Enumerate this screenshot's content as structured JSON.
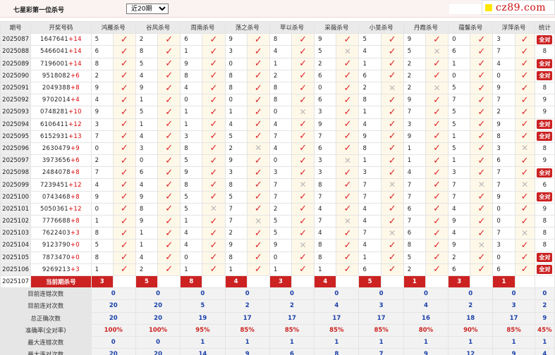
{
  "header": {
    "title": "七星彩第一位杀号",
    "period_select": "近20期"
  },
  "logo": {
    "text": "cz89.com"
  },
  "columns": {
    "issue": "期号",
    "draw": "开奖号码",
    "experts": [
      "鸿雁杀号",
      "谷风杀号",
      "周南杀号",
      "荡之杀号",
      "苹以杀号",
      "采薇杀号",
      "小旻杀号",
      "丹霞杀号",
      "蕴馨杀号",
      "浮萍杀号"
    ],
    "stat": "统计"
  },
  "rows": [
    {
      "issue": "2025087",
      "draw": "1647641",
      "plus": "+14",
      "kills": [
        "5",
        "2",
        "6",
        "9",
        "8",
        "9",
        "5",
        "9",
        "0",
        "3"
      ],
      "hits": [
        1,
        1,
        1,
        1,
        1,
        1,
        1,
        1,
        1,
        1
      ],
      "stat": "全对"
    },
    {
      "issue": "2025088",
      "draw": "5466041",
      "plus": "+14",
      "kills": [
        "6",
        "8",
        "1",
        "3",
        "4",
        "5",
        "4",
        "5",
        "6",
        "7"
      ],
      "hits": [
        1,
        1,
        1,
        1,
        1,
        0,
        1,
        0,
        1,
        1
      ],
      "stat": "8"
    },
    {
      "issue": "2025089",
      "draw": "7196001",
      "plus": "+14",
      "kills": [
        "8",
        "5",
        "9",
        "0",
        "1",
        "2",
        "1",
        "2",
        "1",
        "4"
      ],
      "hits": [
        1,
        1,
        1,
        1,
        1,
        1,
        1,
        1,
        1,
        1
      ],
      "stat": "全对"
    },
    {
      "issue": "2025090",
      "draw": "9518082",
      "plus": "+6",
      "kills": [
        "2",
        "4",
        "8",
        "8",
        "2",
        "6",
        "6",
        "2",
        "0",
        "0"
      ],
      "hits": [
        1,
        1,
        1,
        1,
        1,
        1,
        1,
        1,
        1,
        1
      ],
      "stat": "全对"
    },
    {
      "issue": "2025091",
      "draw": "2049388",
      "plus": "+8",
      "kills": [
        "9",
        "9",
        "4",
        "8",
        "8",
        "0",
        "2",
        "2",
        "5",
        "9"
      ],
      "hits": [
        1,
        1,
        1,
        1,
        1,
        1,
        0,
        0,
        1,
        1
      ],
      "stat": "8"
    },
    {
      "issue": "2025092",
      "draw": "9702014",
      "plus": "+4",
      "kills": [
        "4",
        "1",
        "0",
        "0",
        "8",
        "6",
        "8",
        "9",
        "7",
        "7"
      ],
      "hits": [
        1,
        1,
        1,
        1,
        1,
        1,
        1,
        1,
        1,
        1
      ],
      "stat": "9"
    },
    {
      "issue": "2025093",
      "draw": "0748281",
      "plus": "+10",
      "kills": [
        "9",
        "5",
        "1",
        "1",
        "0",
        "3",
        "1",
        "7",
        "5",
        "2"
      ],
      "hits": [
        1,
        1,
        1,
        1,
        0,
        1,
        1,
        1,
        1,
        1
      ],
      "stat": "9"
    },
    {
      "issue": "2025094",
      "draw": "6106411",
      "plus": "+12",
      "kills": [
        "3",
        "1",
        "1",
        "4",
        "4",
        "9",
        "4",
        "3",
        "5",
        "9"
      ],
      "hits": [
        1,
        1,
        1,
        1,
        1,
        1,
        1,
        1,
        1,
        1
      ],
      "stat": "全对"
    },
    {
      "issue": "2025095",
      "draw": "6152931",
      "plus": "+13",
      "kills": [
        "7",
        "4",
        "3",
        "5",
        "7",
        "7",
        "9",
        "9",
        "1",
        "8"
      ],
      "hits": [
        1,
        1,
        1,
        1,
        1,
        1,
        1,
        1,
        1,
        1
      ],
      "stat": "全对"
    },
    {
      "issue": "2025096",
      "draw": "2630479",
      "plus": "+9",
      "kills": [
        "0",
        "3",
        "8",
        "2",
        "4",
        "6",
        "8",
        "1",
        "5",
        "3"
      ],
      "hits": [
        1,
        1,
        1,
        0,
        1,
        1,
        1,
        1,
        1,
        0
      ],
      "stat": "8"
    },
    {
      "issue": "2025097",
      "draw": "3973656",
      "plus": "+6",
      "kills": [
        "2",
        "0",
        "5",
        "9",
        "0",
        "3",
        "1",
        "1",
        "1",
        "6"
      ],
      "hits": [
        1,
        1,
        1,
        1,
        1,
        0,
        1,
        1,
        1,
        1
      ],
      "stat": "9"
    },
    {
      "issue": "2025098",
      "draw": "2484078",
      "plus": "+8",
      "kills": [
        "7",
        "6",
        "9",
        "3",
        "3",
        "3",
        "3",
        "4",
        "3",
        "7"
      ],
      "hits": [
        1,
        1,
        1,
        1,
        1,
        1,
        1,
        1,
        1,
        1
      ],
      "stat": "全对"
    },
    {
      "issue": "2025099",
      "draw": "7239451",
      "plus": "+12",
      "kills": [
        "4",
        "4",
        "8",
        "8",
        "7",
        "8",
        "7",
        "7",
        "7",
        "7"
      ],
      "hits": [
        1,
        1,
        1,
        1,
        0,
        1,
        0,
        1,
        0,
        0
      ],
      "stat": "6"
    },
    {
      "issue": "2025100",
      "draw": "0743468",
      "plus": "+8",
      "kills": [
        "9",
        "9",
        "5",
        "5",
        "7",
        "7",
        "7",
        "7",
        "7",
        "9"
      ],
      "hits": [
        1,
        1,
        1,
        1,
        1,
        1,
        1,
        1,
        1,
        1
      ],
      "stat": "全对"
    },
    {
      "issue": "2025101",
      "draw": "5050361",
      "plus": "+12",
      "kills": [
        "0",
        "8",
        "5",
        "7",
        "2",
        "4",
        "4",
        "6",
        "4",
        "0"
      ],
      "hits": [
        1,
        1,
        0,
        1,
        1,
        1,
        1,
        1,
        1,
        1
      ],
      "stat": "9"
    },
    {
      "issue": "2025102",
      "draw": "7776688",
      "plus": "+8",
      "kills": [
        "1",
        "9",
        "1",
        "7",
        "5",
        "7",
        "4",
        "7",
        "9",
        "0"
      ],
      "hits": [
        1,
        1,
        1,
        0,
        1,
        0,
        1,
        1,
        1,
        1
      ],
      "stat": "8"
    },
    {
      "issue": "2025103",
      "draw": "7622403",
      "plus": "+3",
      "kills": [
        "8",
        "1",
        "4",
        "2",
        "5",
        "4",
        "7",
        "6",
        "4",
        "7"
      ],
      "hits": [
        1,
        1,
        1,
        1,
        1,
        1,
        0,
        1,
        1,
        0
      ],
      "stat": "8"
    },
    {
      "issue": "2025104",
      "draw": "9123790",
      "plus": "+0",
      "kills": [
        "5",
        "1",
        "4",
        "9",
        "9",
        "8",
        "4",
        "8",
        "9",
        "3"
      ],
      "hits": [
        1,
        1,
        1,
        1,
        0,
        1,
        1,
        1,
        0,
        1
      ],
      "stat": "8"
    },
    {
      "issue": "2025105",
      "draw": "7873470",
      "plus": "+0",
      "kills": [
        "8",
        "4",
        "0",
        "8",
        "0",
        "8",
        "1",
        "5",
        "2",
        "0"
      ],
      "hits": [
        1,
        1,
        1,
        1,
        1,
        1,
        1,
        1,
        1,
        1
      ],
      "stat": "全对"
    },
    {
      "issue": "2025106",
      "draw": "9269213",
      "plus": "+3",
      "kills": [
        "1",
        "2",
        "1",
        "1",
        "1",
        "1",
        "6",
        "2",
        "6",
        "6"
      ],
      "hits": [
        1,
        1,
        1,
        1,
        1,
        1,
        1,
        1,
        1,
        1
      ],
      "stat": "全对"
    }
  ],
  "current": {
    "issue": "2025107",
    "label": "当前期杀号",
    "kills": [
      "3",
      "5",
      "8",
      "4",
      "3",
      "4",
      "5",
      "1",
      "3",
      "1"
    ]
  },
  "stats": [
    {
      "label": "目前连错次数",
      "values": [
        "0",
        "0",
        "0",
        "0",
        "0",
        "0",
        "0",
        "0",
        "0",
        "0"
      ],
      "stat": "0"
    },
    {
      "label": "目前连对次数",
      "values": [
        "20",
        "20",
        "5",
        "2",
        "2",
        "4",
        "3",
        "4",
        "2",
        "3"
      ],
      "stat": "2"
    },
    {
      "label": "总正确次数",
      "values": [
        "20",
        "20",
        "19",
        "17",
        "17",
        "17",
        "17",
        "16",
        "18",
        "17"
      ],
      "stat": "9"
    },
    {
      "label": "准确率(全对率)",
      "values": [
        "100%",
        "100%",
        "95%",
        "85%",
        "85%",
        "85%",
        "85%",
        "80%",
        "90%",
        "85%"
      ],
      "stat": "45%"
    },
    {
      "label": "最大连错次数",
      "values": [
        "0",
        "0",
        "1",
        "1",
        "1",
        "1",
        "1",
        "1",
        "1",
        "1"
      ],
      "stat": "1"
    },
    {
      "label": "最大连对次数",
      "values": [
        "20",
        "20",
        "14",
        "9",
        "6",
        "8",
        "7",
        "9",
        "12",
        "9"
      ],
      "stat": "4"
    }
  ]
}
